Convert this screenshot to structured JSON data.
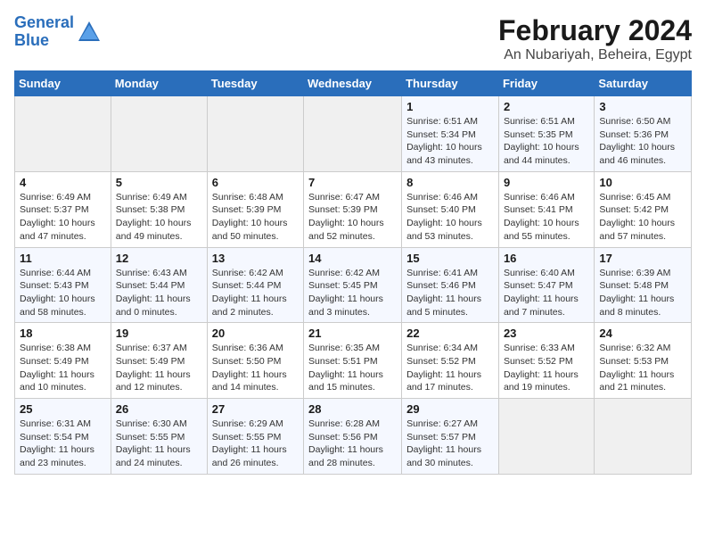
{
  "logo": {
    "line1": "General",
    "line2": "Blue"
  },
  "title": "February 2024",
  "subtitle": "An Nubariyah, Beheira, Egypt",
  "days_of_week": [
    "Sunday",
    "Monday",
    "Tuesday",
    "Wednesday",
    "Thursday",
    "Friday",
    "Saturday"
  ],
  "weeks": [
    [
      {
        "day": "",
        "detail": ""
      },
      {
        "day": "",
        "detail": ""
      },
      {
        "day": "",
        "detail": ""
      },
      {
        "day": "",
        "detail": ""
      },
      {
        "day": "1",
        "detail": "Sunrise: 6:51 AM\nSunset: 5:34 PM\nDaylight: 10 hours\nand 43 minutes."
      },
      {
        "day": "2",
        "detail": "Sunrise: 6:51 AM\nSunset: 5:35 PM\nDaylight: 10 hours\nand 44 minutes."
      },
      {
        "day": "3",
        "detail": "Sunrise: 6:50 AM\nSunset: 5:36 PM\nDaylight: 10 hours\nand 46 minutes."
      }
    ],
    [
      {
        "day": "4",
        "detail": "Sunrise: 6:49 AM\nSunset: 5:37 PM\nDaylight: 10 hours\nand 47 minutes."
      },
      {
        "day": "5",
        "detail": "Sunrise: 6:49 AM\nSunset: 5:38 PM\nDaylight: 10 hours\nand 49 minutes."
      },
      {
        "day": "6",
        "detail": "Sunrise: 6:48 AM\nSunset: 5:39 PM\nDaylight: 10 hours\nand 50 minutes."
      },
      {
        "day": "7",
        "detail": "Sunrise: 6:47 AM\nSunset: 5:39 PM\nDaylight: 10 hours\nand 52 minutes."
      },
      {
        "day": "8",
        "detail": "Sunrise: 6:46 AM\nSunset: 5:40 PM\nDaylight: 10 hours\nand 53 minutes."
      },
      {
        "day": "9",
        "detail": "Sunrise: 6:46 AM\nSunset: 5:41 PM\nDaylight: 10 hours\nand 55 minutes."
      },
      {
        "day": "10",
        "detail": "Sunrise: 6:45 AM\nSunset: 5:42 PM\nDaylight: 10 hours\nand 57 minutes."
      }
    ],
    [
      {
        "day": "11",
        "detail": "Sunrise: 6:44 AM\nSunset: 5:43 PM\nDaylight: 10 hours\nand 58 minutes."
      },
      {
        "day": "12",
        "detail": "Sunrise: 6:43 AM\nSunset: 5:44 PM\nDaylight: 11 hours\nand 0 minutes."
      },
      {
        "day": "13",
        "detail": "Sunrise: 6:42 AM\nSunset: 5:44 PM\nDaylight: 11 hours\nand 2 minutes."
      },
      {
        "day": "14",
        "detail": "Sunrise: 6:42 AM\nSunset: 5:45 PM\nDaylight: 11 hours\nand 3 minutes."
      },
      {
        "day": "15",
        "detail": "Sunrise: 6:41 AM\nSunset: 5:46 PM\nDaylight: 11 hours\nand 5 minutes."
      },
      {
        "day": "16",
        "detail": "Sunrise: 6:40 AM\nSunset: 5:47 PM\nDaylight: 11 hours\nand 7 minutes."
      },
      {
        "day": "17",
        "detail": "Sunrise: 6:39 AM\nSunset: 5:48 PM\nDaylight: 11 hours\nand 8 minutes."
      }
    ],
    [
      {
        "day": "18",
        "detail": "Sunrise: 6:38 AM\nSunset: 5:49 PM\nDaylight: 11 hours\nand 10 minutes."
      },
      {
        "day": "19",
        "detail": "Sunrise: 6:37 AM\nSunset: 5:49 PM\nDaylight: 11 hours\nand 12 minutes."
      },
      {
        "day": "20",
        "detail": "Sunrise: 6:36 AM\nSunset: 5:50 PM\nDaylight: 11 hours\nand 14 minutes."
      },
      {
        "day": "21",
        "detail": "Sunrise: 6:35 AM\nSunset: 5:51 PM\nDaylight: 11 hours\nand 15 minutes."
      },
      {
        "day": "22",
        "detail": "Sunrise: 6:34 AM\nSunset: 5:52 PM\nDaylight: 11 hours\nand 17 minutes."
      },
      {
        "day": "23",
        "detail": "Sunrise: 6:33 AM\nSunset: 5:52 PM\nDaylight: 11 hours\nand 19 minutes."
      },
      {
        "day": "24",
        "detail": "Sunrise: 6:32 AM\nSunset: 5:53 PM\nDaylight: 11 hours\nand 21 minutes."
      }
    ],
    [
      {
        "day": "25",
        "detail": "Sunrise: 6:31 AM\nSunset: 5:54 PM\nDaylight: 11 hours\nand 23 minutes."
      },
      {
        "day": "26",
        "detail": "Sunrise: 6:30 AM\nSunset: 5:55 PM\nDaylight: 11 hours\nand 24 minutes."
      },
      {
        "day": "27",
        "detail": "Sunrise: 6:29 AM\nSunset: 5:55 PM\nDaylight: 11 hours\nand 26 minutes."
      },
      {
        "day": "28",
        "detail": "Sunrise: 6:28 AM\nSunset: 5:56 PM\nDaylight: 11 hours\nand 28 minutes."
      },
      {
        "day": "29",
        "detail": "Sunrise: 6:27 AM\nSunset: 5:57 PM\nDaylight: 11 hours\nand 30 minutes."
      },
      {
        "day": "",
        "detail": ""
      },
      {
        "day": "",
        "detail": ""
      }
    ]
  ]
}
